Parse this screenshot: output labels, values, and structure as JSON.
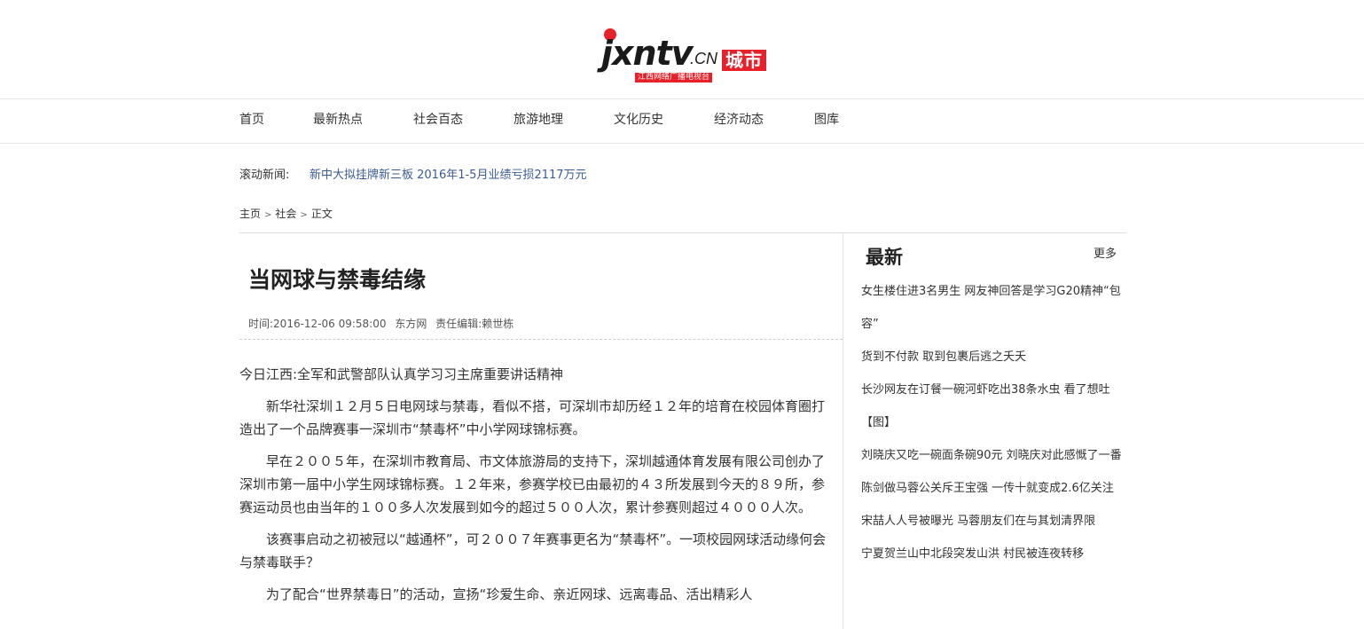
{
  "header": {
    "logo": {
      "main_text": "jxntv",
      "domain_text": ".CN",
      "city_text": "城市",
      "subtitle": "江西网络广播电视台"
    }
  },
  "nav": {
    "items": [
      {
        "label": "首页"
      },
      {
        "label": "最新热点"
      },
      {
        "label": "社会百态"
      },
      {
        "label": "旅游地理"
      },
      {
        "label": "文化历史"
      },
      {
        "label": "经济动态"
      },
      {
        "label": "图库"
      }
    ]
  },
  "scroll_news": {
    "label": "滚动新闻:",
    "headline": "新中大拟挂牌新三板 2016年1-5月业绩亏损2117万元"
  },
  "breadcrumb": {
    "home": "主页",
    "section": "社会",
    "current": "正文",
    "separator": ">"
  },
  "article": {
    "title": "当网球与禁毒结缘",
    "time": "时间:2016-12-06 09:58:00",
    "source": "东方网",
    "editor": "责任编辑:赖世栋",
    "paragraphs": [
      "今日江西:全军和武警部队认真学习习主席重要讲话精神",
      "新华社深圳１２月５日电网球与禁毒，看似不搭，可深圳市却历经１２年的培育在校园体育圈打造出了一个品牌赛事一深圳市“禁毒杯”中小学网球锦标赛。",
      "早在２００５年，在深圳市教育局、市文体旅游局的支持下，深圳越通体育发展有限公司创办了深圳市第一届中小学生网球锦标赛。１２年来，参赛学校已由最初的４３所发展到今天的８９所，参赛运动员也由当年的１００多人次发展到如今的超过５００人次，累计参赛则超过４０００人次。",
      "该赛事启动之初被冠以“越通杯”，可２００７年赛事更名为“禁毒杯”。一项校园网球活动缘何会与禁毒联手？",
      "为了配合“世界禁毒日”的活动，宣扬“珍爱生命、亲近网球、远离毒品、活出精彩人"
    ]
  },
  "sidebar": {
    "title": "最新",
    "more_label": "更多",
    "items": [
      "女生楼住进3名男生 网友神回答是学习G20精神“包容”",
      "货到不付款 取到包裹后逃之夭夭",
      "长沙网友在订餐一碗河虾吃出38条水虫 看了想吐【图】",
      "刘晓庆又吃一碗面条碗90元 刘晓庆对此感慨了一番",
      "陈剑做马蓉公关斥王宝强 一传十就变成2.6亿关注",
      "宋喆人人号被曝光 马蓉朋友们在与其划清界限",
      "宁夏贺兰山中北段突发山洪 村民被连夜转移"
    ]
  },
  "colors": {
    "brand_red": "#e8202a",
    "link_blue": "#3a5b96",
    "text": "#333333"
  }
}
